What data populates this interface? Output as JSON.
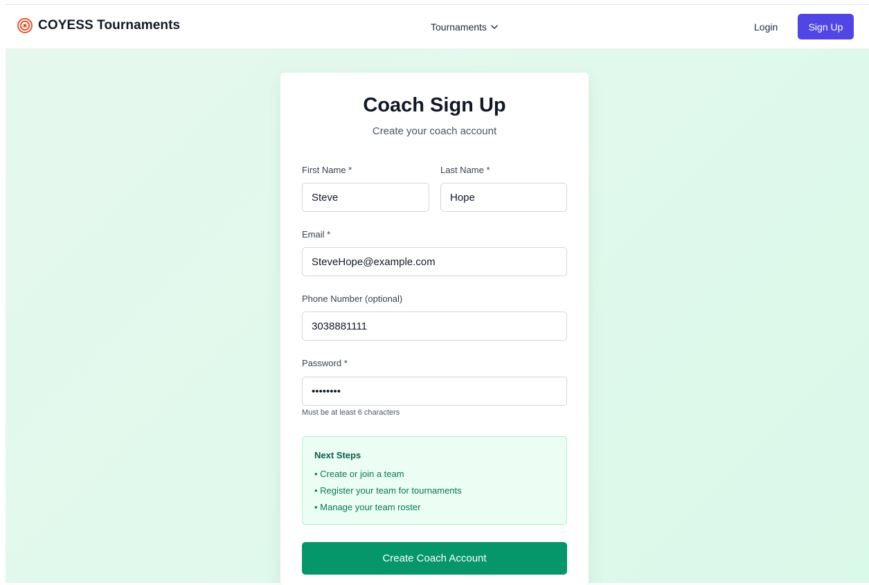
{
  "nav": {
    "brand_icon": "target-icon",
    "brand_name": "COYESS Tournaments",
    "tournaments_label": "Tournaments",
    "tournaments_icon": "chevron-down-icon",
    "login_label": "Login",
    "signup_label": "Sign Up"
  },
  "form": {
    "title": "Coach Sign Up",
    "subtitle": "Create your coach account",
    "first_name": {
      "label": "First Name *",
      "value": "Steve"
    },
    "last_name": {
      "label": "Last Name *",
      "value": "Hope"
    },
    "email": {
      "label": "Email *",
      "value": "SteveHope@example.com"
    },
    "phone": {
      "label": "Phone Number (optional)",
      "value": "3038881111"
    },
    "password": {
      "label": "Password *",
      "value": "Coach123",
      "hint": "Must be at least 6 characters"
    },
    "next_steps": {
      "title": "Next Steps",
      "items": [
        "• Create or join a team",
        "• Register your team for tournaments",
        "• Manage your team roster"
      ]
    },
    "submit_label": "Create Coach Account"
  },
  "colors": {
    "brand_icon": "#e8552b",
    "primary_button": "#4f46e5",
    "submit_button": "#059669",
    "background": "#e0f9ec",
    "steps_background": "#ecfdf3",
    "steps_border": "#a7f3d0",
    "steps_text": "#047857"
  }
}
